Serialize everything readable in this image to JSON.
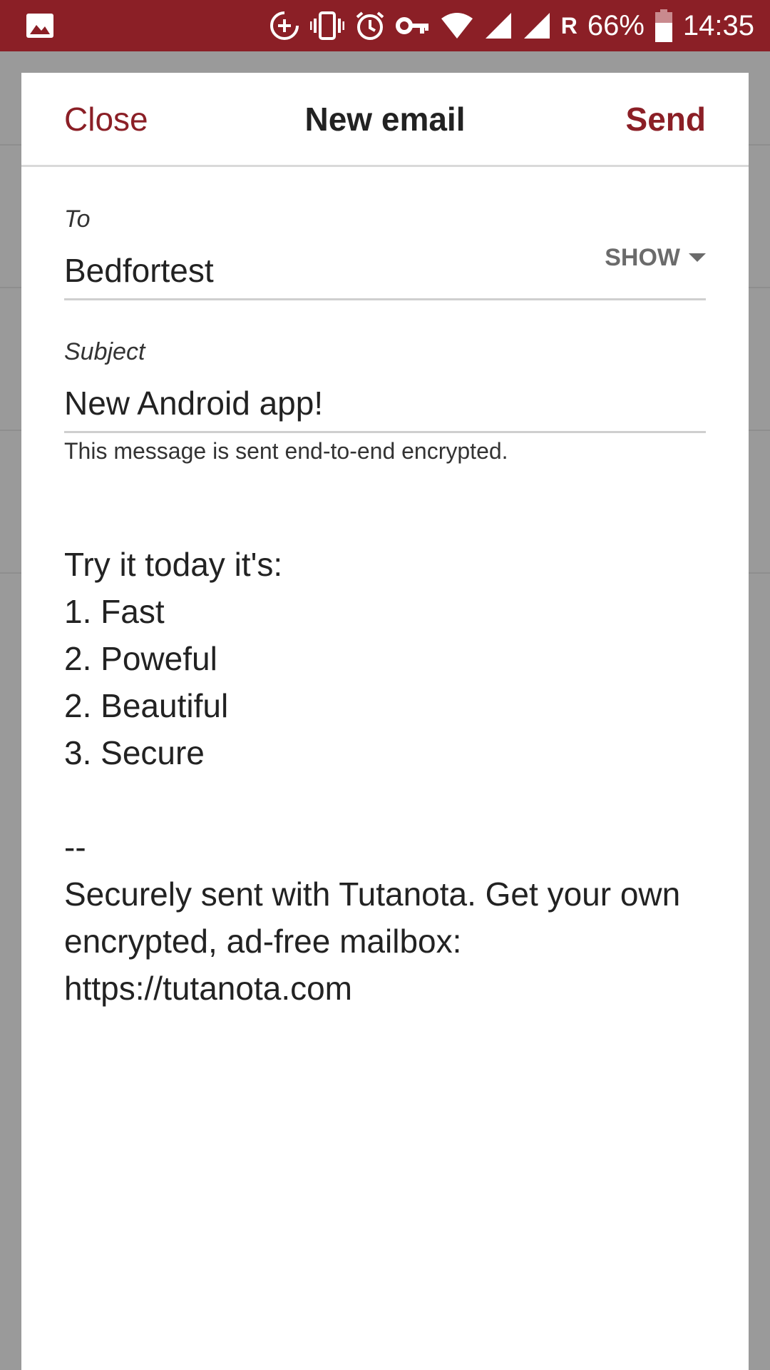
{
  "status_bar": {
    "carrier_indicator": "R",
    "battery": "66%",
    "time": "14:35",
    "icons": [
      "image-icon",
      "data-saver-icon",
      "vibrate-icon",
      "alarm-icon",
      "vpn-key-icon",
      "wifi-icon",
      "signal-icon",
      "signal-icon",
      "battery-icon"
    ]
  },
  "header": {
    "close_label": "Close",
    "title": "New email",
    "send_label": "Send"
  },
  "to_field": {
    "label": "To",
    "value": "Bedfortest",
    "show_label": "SHOW"
  },
  "subject_field": {
    "label": "Subject",
    "value": "New Android app!",
    "helper": "This message is sent end-to-end encrypted."
  },
  "body": {
    "lines": [
      "Try it today it's:",
      "1. Fast",
      "2. Poweful",
      "2. Beautiful",
      "3. Secure",
      "",
      "--",
      "Securely sent with Tutanota. Get your own",
      "encrypted, ad-free mailbox:",
      "https://tutanota.com"
    ]
  },
  "colors": {
    "accent": "#8b1f26",
    "status_bar": "#8b1f26",
    "overlay": "#9a9a9a"
  }
}
